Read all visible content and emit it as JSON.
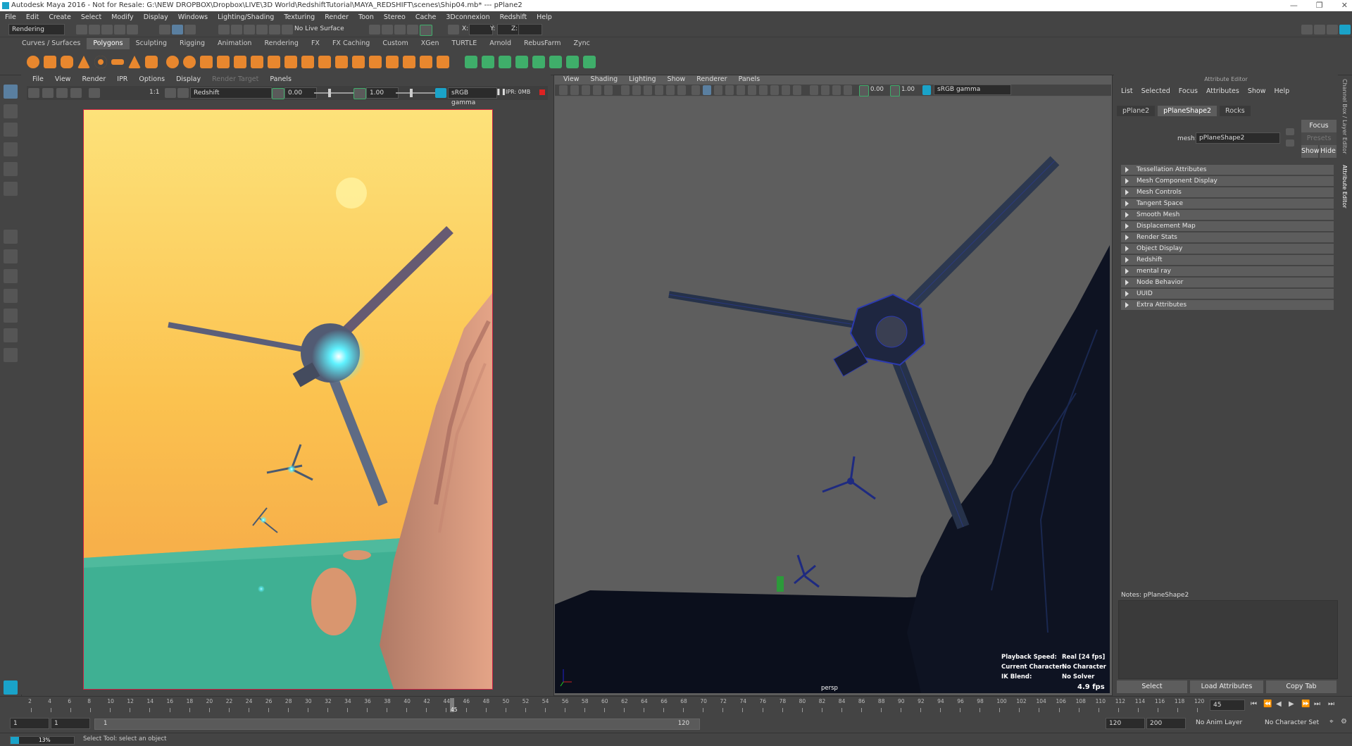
{
  "window": {
    "title": "Autodesk Maya 2016 - Not for Resale: G:\\NEW DROPBOX\\Dropbox\\LIVE\\3D World\\RedshiftTutorial\\MAYA_REDSHIFT\\scenes\\Ship04.mb*  ---  pPlane2",
    "minimize": "—",
    "maximize": "❐",
    "close": "✕"
  },
  "menubar": [
    "File",
    "Edit",
    "Create",
    "Select",
    "Modify",
    "Display",
    "Windows",
    "Lighting/Shading",
    "Texturing",
    "Render",
    "Toon",
    "Stereo",
    "Cache",
    "3Dconnexion",
    "Redshift",
    "Help"
  ],
  "statusline": {
    "menuset": "Rendering",
    "live_surface": "No Live Surface",
    "x_label": "X:",
    "y_label": "Y:",
    "z_label": "Z:"
  },
  "shelf_tabs": [
    "Curves / Surfaces",
    "Polygons",
    "Sculpting",
    "Rigging",
    "Animation",
    "Rendering",
    "FX",
    "FX Caching",
    "Custom",
    "XGen",
    "TURTLE",
    "Arnold",
    "RebusFarm",
    "Zync"
  ],
  "shelf_active": "Polygons",
  "render_view": {
    "menu": [
      "File",
      "View",
      "Render",
      "IPR",
      "Options",
      "Display",
      "Render Target",
      "Panels"
    ],
    "ratio": "1:1",
    "renderer": "Redshift",
    "exposure": "0.00",
    "gamma": "1.00",
    "colorspace": "sRGB gamma",
    "ipr_mem": "IPR: 0MB"
  },
  "viewport": {
    "menu": [
      "View",
      "Shading",
      "Lighting",
      "Show",
      "Renderer",
      "Panels"
    ],
    "exposure": "0.00",
    "gamma": "1.00",
    "colorspace": "sRGB gamma",
    "camera": "persp",
    "hud": {
      "playback_label": "Playback Speed:",
      "playback_value": "Real [24 fps]",
      "character_label": "Current Character:",
      "character_value": "No Character",
      "ik_label": "IK Blend:",
      "ik_value": "No Solver",
      "fps": "4.9 fps"
    }
  },
  "attribute_editor": {
    "title": "Attribute Editor",
    "menu": [
      "List",
      "Selected",
      "Focus",
      "Attributes",
      "Show",
      "Help"
    ],
    "tabs": [
      "pPlane2",
      "pPlaneShape2",
      "Rocks"
    ],
    "active_tab": "pPlaneShape2",
    "mesh_label": "mesh:",
    "mesh_value": "pPlaneShape2",
    "focus_btn": "Focus",
    "presets_btn": "Presets",
    "show_btn": "Show",
    "hide_btn": "Hide",
    "sections": [
      "Tessellation Attributes",
      "Mesh Component Display",
      "Mesh Controls",
      "Tangent Space",
      "Smooth Mesh",
      "Displacement Map",
      "Render Stats",
      "Object Display",
      "Redshift",
      "mental ray",
      "Node Behavior",
      "UUID",
      "Extra Attributes"
    ],
    "notes_label": "Notes:  pPlaneShape2",
    "select_btn": "Select",
    "load_btn": "Load Attributes",
    "copy_btn": "Copy Tab"
  },
  "side_tabs": [
    "Channel Box / Layer Editor",
    "Attribute Editor"
  ],
  "timeslider": {
    "ticks": [
      "2",
      "4",
      "6",
      "8",
      "10",
      "12",
      "14",
      "16",
      "18",
      "20",
      "22",
      "24",
      "26",
      "28",
      "30",
      "32",
      "34",
      "36",
      "38",
      "40",
      "42",
      "44",
      "46",
      "48",
      "50",
      "52",
      "54",
      "56",
      "58",
      "60",
      "62",
      "64",
      "66",
      "68",
      "70",
      "72",
      "74",
      "76",
      "78",
      "80",
      "82",
      "84",
      "86",
      "88",
      "90",
      "92",
      "94",
      "96",
      "98",
      "100",
      "102",
      "104",
      "106",
      "108",
      "110",
      "112",
      "114",
      "116",
      "118",
      "120"
    ],
    "current_frame_marker": "45",
    "current_frame": "45"
  },
  "range": {
    "start": "1",
    "playback_start": "1",
    "slider_start": "1",
    "slider_end": "120",
    "playback_end": "120",
    "end": "200",
    "anim_layer": "No Anim Layer",
    "character_set": "No Character Set"
  },
  "help": {
    "progress": "13%",
    "progress_fraction": 0.13,
    "message": "Select Tool: select an object"
  },
  "colors": {
    "accent": "#1aa3c9",
    "shelf_orange": "#e8872e",
    "shelf_green": "#3fae6a"
  }
}
